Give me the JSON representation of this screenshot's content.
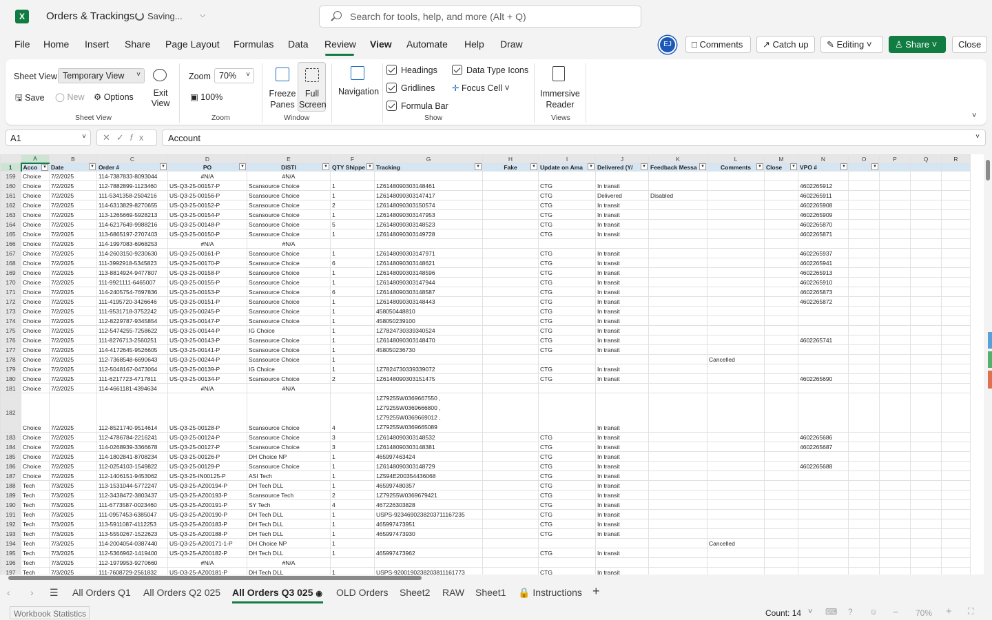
{
  "app": {
    "name": "Excel",
    "logo_letter": "X"
  },
  "title": {
    "doc": "Orders & Trackings",
    "saving": "Saving...",
    "chevron": "⌵"
  },
  "search": {
    "placeholder": "Search for tools, help, and more (Alt + Q)"
  },
  "menu": [
    "File",
    "Home",
    "Insert",
    "Share",
    "Page Layout",
    "Formulas",
    "Data",
    "Review",
    "View",
    "Automate",
    "Help",
    "Draw"
  ],
  "menu_active": "View",
  "titlebuttons": {
    "avatar": "EJ",
    "comments": "Comments",
    "catchup": "Catch up",
    "editing": "Editing",
    "share": "Share",
    "close": "Close"
  },
  "ribbon": {
    "sheet_view_label": "Sheet View",
    "sheet_view_value": "Temporary View",
    "save": "Save",
    "new": "New",
    "options": "Options",
    "exit_view": "Exit View",
    "group_sheet_view": "Sheet View",
    "zoom_label": "Zoom",
    "zoom_value": "70%",
    "zoom_100": "100%",
    "group_zoom": "Zoom",
    "freeze_panes": "Freeze Panes",
    "full_screen": "Full Screen",
    "group_window": "Window",
    "navigation": "Navigation",
    "headings": "Headings",
    "gridlines": "Gridlines",
    "formula_bar": "Formula Bar",
    "data_type_icons": "Data Type Icons",
    "focus_cell": "Focus Cell",
    "group_show": "Show",
    "immersive_reader": "Immersive Reader",
    "group_views": "Views"
  },
  "formula": {
    "namebox": "A1",
    "fx": "𝑓x",
    "value": "Account"
  },
  "columns": [
    "A",
    "B",
    "C",
    "D",
    "E",
    "F",
    "G",
    "H",
    "I",
    "J",
    "K",
    "L",
    "M",
    "N",
    "O",
    "P",
    "Q",
    "R"
  ],
  "header_row": {
    "num": "1",
    "cells": [
      "Acco",
      "Date",
      "Order #",
      "PO",
      "DISTI",
      "QTY Shippe",
      "Tracking",
      "Fake",
      "Update on Ama",
      "Delivered (Y/",
      "Feedback Messa",
      "Comments",
      "Close",
      "VPO #",
      "",
      "",
      "",
      ""
    ]
  },
  "rows": [
    {
      "n": "159",
      "c": [
        "Choice",
        "7/2/2025",
        "114-7387833-8093044",
        "#N/A",
        "#N/A",
        "",
        "",
        "",
        "",
        "",
        "",
        "",
        "",
        "",
        "",
        "",
        "",
        ""
      ]
    },
    {
      "n": "160",
      "c": [
        "Choice",
        "7/2/2025",
        "112-7882899-1123460",
        "US-Q3-25-00157-P",
        "Scansource Choice",
        "1",
        "1Z6148090303148461",
        "",
        "CTG",
        "In transit",
        "",
        "",
        "",
        "4602265912",
        "",
        "",
        "",
        ""
      ]
    },
    {
      "n": "161",
      "c": [
        "Choice",
        "7/2/2025",
        "111-5341358-2504216",
        "US-Q3-25-00156-P",
        "Scansource Choice",
        "1",
        "1Z6148090303147417",
        "",
        "CTG",
        "Delivered",
        "Disabled",
        "",
        "",
        "4602265911",
        "",
        "",
        "",
        ""
      ]
    },
    {
      "n": "162",
      "c": [
        "Choice",
        "7/2/2025",
        "114-6313829-8270655",
        "US-Q3-25-00152-P",
        "Scansource Choice",
        "2",
        "1Z6148090303150574",
        "",
        "CTG",
        "In transit",
        "",
        "",
        "",
        "4602265908",
        "",
        "",
        "",
        ""
      ]
    },
    {
      "n": "163",
      "c": [
        "Choice",
        "7/2/2025",
        "113-1265669-5928213",
        "US-Q3-25-00154-P",
        "Scansource Choice",
        "1",
        "1Z6148090303147953",
        "",
        "CTG",
        "In transit",
        "",
        "",
        "",
        "4602265909",
        "",
        "",
        "",
        ""
      ]
    },
    {
      "n": "164",
      "c": [
        "Choice",
        "7/2/2025",
        "114-6217649-9988216",
        "US-Q3-25-00148-P",
        "Scansource Choice",
        "5",
        "1Z6148090303148523",
        "",
        "CTG",
        "In transit",
        "",
        "",
        "",
        "4602265870",
        "",
        "",
        "",
        ""
      ]
    },
    {
      "n": "165",
      "c": [
        "Choice",
        "7/2/2025",
        "113-6865197-2707403",
        "US-Q3-25-00150-P",
        "Scansource Choice",
        "1",
        "1Z6148090303149728",
        "",
        "CTG",
        "In transit",
        "",
        "",
        "",
        "4602265871",
        "",
        "",
        "",
        ""
      ]
    },
    {
      "n": "166",
      "c": [
        "Choice",
        "7/2/2025",
        "114-1997083-6968253",
        "#N/A",
        "#N/A",
        "",
        "",
        "",
        "",
        "",
        "",
        "",
        "",
        "",
        "",
        "",
        "",
        ""
      ]
    },
    {
      "n": "167",
      "c": [
        "Choice",
        "7/2/2025",
        "114-2603150-9230630",
        "US-Q3-25-00161-P",
        "Scansource Choice",
        "1",
        "1Z6148090303147971",
        "",
        "CTG",
        "In transit",
        "",
        "",
        "",
        "4602265937",
        "",
        "",
        "",
        ""
      ]
    },
    {
      "n": "168",
      "c": [
        "Choice",
        "7/2/2025",
        "111-3992918-5345823",
        "US-Q3-25-00170-P",
        "Scansource Choice",
        "6",
        "1Z6148090303148621",
        "",
        "CTG",
        "In transit",
        "",
        "",
        "",
        "4602265941",
        "",
        "",
        "",
        ""
      ]
    },
    {
      "n": "169",
      "c": [
        "Choice",
        "7/2/2025",
        "113-8814924-9477807",
        "US-Q3-25-00158-P",
        "Scansource Choice",
        "1",
        "1Z6148090303148596",
        "",
        "CTG",
        "In transit",
        "",
        "",
        "",
        "4602265913",
        "",
        "",
        "",
        ""
      ]
    },
    {
      "n": "170",
      "c": [
        "Choice",
        "7/2/2025",
        "111-9921111-6465007",
        "US-Q3-25-00155-P",
        "Scansource Choice",
        "1",
        "1Z6148090303147944",
        "",
        "CTG",
        "In transit",
        "",
        "",
        "",
        "4602265910",
        "",
        "",
        "",
        ""
      ]
    },
    {
      "n": "171",
      "c": [
        "Choice",
        "7/2/2025",
        "114-2405754-7697836",
        "US-Q3-25-00153-P",
        "Scansource Choice",
        "6",
        "1Z6148090303148587",
        "",
        "CTG",
        "In transit",
        "",
        "",
        "",
        "4602265873",
        "",
        "",
        "",
        ""
      ]
    },
    {
      "n": "172",
      "c": [
        "Choice",
        "7/2/2025",
        "111-4195720-3426646",
        "US-Q3-25-00151-P",
        "Scansource Choice",
        "1",
        "1Z6148090303148443",
        "",
        "CTG",
        "In transit",
        "",
        "",
        "",
        "4602265872",
        "",
        "",
        "",
        ""
      ]
    },
    {
      "n": "173",
      "c": [
        "Choice",
        "7/2/2025",
        "111-9531718-3752242",
        "US-Q3-25-00245-P",
        "Scansource Choice",
        "1",
        "458050448810",
        "",
        "CTG",
        "In transit",
        "",
        "",
        "",
        "",
        "",
        "",
        "",
        ""
      ]
    },
    {
      "n": "174",
      "c": [
        "Choice",
        "7/2/2025",
        "112-8229787-9345854",
        "US-Q3-25-00147-P",
        "Scansource Choice",
        "1",
        "458050239100",
        "",
        "CTG",
        "In transit",
        "",
        "",
        "",
        "",
        "",
        "",
        "",
        ""
      ]
    },
    {
      "n": "175",
      "c": [
        "Choice",
        "7/2/2025",
        "112-5474255-7258622",
        "US-Q3-25-00144-P",
        "IG Choice",
        "1",
        "1Z7824730339340524",
        "",
        "CTG",
        "In transit",
        "",
        "",
        "",
        "",
        "",
        "",
        "",
        ""
      ]
    },
    {
      "n": "176",
      "c": [
        "Choice",
        "7/2/2025",
        "111-8276713-2560251",
        "US-Q3-25-00143-P",
        "Scansource Choice",
        "1",
        "1Z6148090303148470",
        "",
        "CTG",
        "In transit",
        "",
        "",
        "",
        "4602265741",
        "",
        "",
        "",
        ""
      ]
    },
    {
      "n": "177",
      "c": [
        "Choice",
        "7/2/2025",
        "114-4172645-9526605",
        "US-Q3-25-00141-P",
        "Scansource Choice",
        "1",
        "458050236730",
        "",
        "CTG",
        "In transit",
        "",
        "",
        "",
        "",
        "",
        "",
        "",
        ""
      ]
    },
    {
      "n": "178",
      "c": [
        "Choice",
        "7/2/2025",
        "112-7368548-6690643",
        "US-Q3-25-00244-P",
        "Scansource Choice",
        "1",
        "",
        "",
        "",
        "",
        "",
        "Cancelled",
        "",
        "",
        "",
        "",
        "",
        ""
      ]
    },
    {
      "n": "179",
      "c": [
        "Choice",
        "7/2/2025",
        "112-5048167-0473064",
        "US-Q3-25-00139-P",
        "IG Choice",
        "1",
        "1Z7824730339339072",
        "",
        "CTG",
        "In transit",
        "",
        "",
        "",
        "",
        "",
        "",
        "",
        ""
      ]
    },
    {
      "n": "180",
      "c": [
        "Choice",
        "7/2/2025",
        "111-6217723-4717811",
        "US-Q3-25-00134-P",
        "Scansource Choice",
        "2",
        "1Z6148090303151475",
        "",
        "CTG",
        "In transit",
        "",
        "",
        "",
        "4602265690",
        "",
        "",
        "",
        ""
      ]
    },
    {
      "n": "181",
      "c": [
        "Choice",
        "7/2/2025",
        "114-4661181-4394634",
        "#N/A",
        "#N/A",
        "",
        "",
        "",
        "",
        "",
        "",
        "",
        "",
        "",
        "",
        "",
        "",
        ""
      ]
    },
    {
      "n": "182",
      "tall": true,
      "c": [
        "Choice",
        "7/2/2025",
        "112-8521740-9514614",
        "US-Q3-25-00128-P",
        "Scansource Choice",
        "4",
        "1Z79255W0369667550 ,|1Z79255W0369666800 ,|1Z79255W0369669012 ,|1Z79255W0369665089",
        "",
        "",
        "In transit",
        "",
        "",
        "",
        "",
        "",
        "",
        "",
        ""
      ]
    },
    {
      "n": "183",
      "c": [
        "Choice",
        "7/2/2025",
        "112-4786784-2216241",
        "US-Q3-25-00124-P",
        "Scansource Choice",
        "3",
        "1Z6148090303148532",
        "",
        "CTG",
        "In transit",
        "",
        "",
        "",
        "4602265686",
        "",
        "",
        "",
        ""
      ]
    },
    {
      "n": "184",
      "c": [
        "Choice",
        "7/2/2025",
        "114-0268939-3366678",
        "US-Q3-25-00127-P",
        "Scansource Choice",
        "3",
        "1Z6148090303148381",
        "",
        "CTG",
        "In transit",
        "",
        "",
        "",
        "4602265687",
        "",
        "",
        "",
        ""
      ]
    },
    {
      "n": "185",
      "c": [
        "Choice",
        "7/2/2025",
        "114-1802841-8708234",
        "US-Q3-25-00126-P",
        "DH Choice NP",
        "1",
        "465997463424",
        "",
        "CTG",
        "In transit",
        "",
        "",
        "",
        "",
        "",
        "",
        "",
        ""
      ]
    },
    {
      "n": "186",
      "c": [
        "Choice",
        "7/2/2025",
        "112-0254103-1549822",
        "US-Q3-25-00129-P",
        "Scansource Choice",
        "1",
        "1Z6148090303148729",
        "",
        "CTG",
        "In transit",
        "",
        "",
        "",
        "4602265688",
        "",
        "",
        "",
        ""
      ]
    },
    {
      "n": "187",
      "c": [
        "Choice",
        "7/2/2025",
        "112-1406151-9453062",
        "US-Q3-25-IN00125-P",
        "ASI Tech",
        "1",
        "1Z594E200354436068",
        "",
        "CTG",
        "In transit",
        "",
        "",
        "",
        "",
        "",
        "",
        "",
        ""
      ]
    },
    {
      "n": "188",
      "c": [
        "Tech",
        "7/3/2025",
        "113-1531044-5772247",
        "US-Q3-25-AZ00194-P",
        "DH Tech DLL",
        "1",
        "465997480357",
        "",
        "CTG",
        "In transit",
        "",
        "",
        "",
        "",
        "",
        "",
        "",
        ""
      ]
    },
    {
      "n": "189",
      "c": [
        "Tech",
        "7/3/2025",
        "112-3438472-3803437",
        "US-Q3-25-AZ00193-P",
        "Scansource Tech",
        "2",
        "1Z79255W0369679421",
        "",
        "CTG",
        "In transit",
        "",
        "",
        "",
        "",
        "",
        "",
        "",
        ""
      ]
    },
    {
      "n": "190",
      "c": [
        "Tech",
        "7/3/2025",
        "111-6773587-0023460",
        "US-Q3-25-AZ00191-P",
        "SY Tech",
        "4",
        "467226303828",
        "",
        "CTG",
        "In transit",
        "",
        "",
        "",
        "",
        "",
        "",
        "",
        ""
      ]
    },
    {
      "n": "191",
      "c": [
        "Tech",
        "7/3/2025",
        "111-0957453-6385047",
        "US-Q3-25-AZ00190-P",
        "DH Tech DLL",
        "1",
        "USPS-9234690238203711167235",
        "",
        "CTG",
        "In transit",
        "",
        "",
        "",
        "",
        "",
        "",
        "",
        ""
      ]
    },
    {
      "n": "192",
      "c": [
        "Tech",
        "7/3/2025",
        "113-5911087-4112253",
        "US-Q3-25-AZ00183-P",
        "DH Tech DLL",
        "1",
        "465997473951",
        "",
        "CTG",
        "In transit",
        "",
        "",
        "",
        "",
        "",
        "",
        "",
        ""
      ]
    },
    {
      "n": "193",
      "c": [
        "Tech",
        "7/3/2025",
        "113-5550267-1522623",
        "US-Q3-25-AZ00188-P",
        "DH Tech DLL",
        "1",
        "465997473930",
        "",
        "CTG",
        "In transit",
        "",
        "",
        "",
        "",
        "",
        "",
        "",
        ""
      ]
    },
    {
      "n": "194",
      "c": [
        "Tech",
        "7/3/2025",
        "114-2004054-0387440",
        "US-Q3-25-AZ00171-1-P",
        "DH Choice NP",
        "1",
        "",
        "",
        "",
        "",
        "",
        "Cancelled",
        "",
        "",
        "",
        "",
        "",
        ""
      ]
    },
    {
      "n": "195",
      "c": [
        "Tech",
        "7/3/2025",
        "112-5366962-1419400",
        "US-Q3-25-AZ00182-P",
        "DH Tech DLL",
        "1",
        "465997473962",
        "",
        "CTG",
        "In transit",
        "",
        "",
        "",
        "",
        "",
        "",
        "",
        ""
      ]
    },
    {
      "n": "196",
      "c": [
        "Tech",
        "7/3/2025",
        "112-1979953-9270660",
        "#N/A",
        "#N/A",
        "",
        "",
        "",
        "",
        "",
        "",
        "",
        "",
        "",
        "",
        "",
        "",
        ""
      ]
    },
    {
      "n": "197",
      "c": [
        "Tech",
        "7/3/2025",
        "111-7608729-2561832",
        "US-Q3-25-AZ00181-P",
        "DH Tech DLL",
        "1",
        "USPS-9200190238203811161773",
        "",
        "CTG",
        "In transit",
        "",
        "",
        "",
        "",
        "",
        "",
        "",
        ""
      ]
    }
  ],
  "sheet_tabs": [
    "All Orders Q1",
    "All Orders Q2 025",
    "All Orders Q3 025",
    "OLD Orders",
    "Sheet2",
    "RAW",
    "Sheet1",
    "Instructions"
  ],
  "active_sheet": "All Orders Q3 025",
  "status": {
    "workbook_stats": "Workbook Statistics",
    "count": "Count: 14",
    "zoom": "70%"
  },
  "colors": {
    "accent": "#107c41",
    "header_fill": "#d5e5f2"
  }
}
